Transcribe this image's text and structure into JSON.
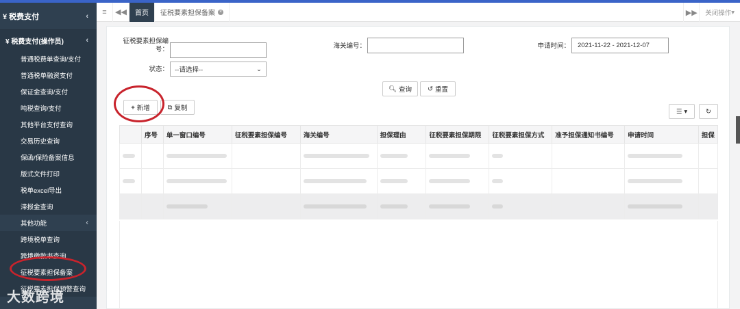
{
  "sidebar": {
    "title": "¥ 税费支付",
    "sub_title": "¥ 税费支付(操作员)",
    "items": [
      "普通税费单查询/支付",
      "普通税单融资支付",
      "保证金查询/支付",
      "吨税查询/支付",
      "其他平台支付查询",
      "交易历史查询",
      "保函/保险备案信息",
      "版式文件打印",
      "税单excel导出",
      "滞报金查询"
    ],
    "group_label": "其他功能",
    "group_items": [
      "跨境税单查询",
      "跨境缴款书查询",
      "征税要素担保备案",
      "征税要素担保预警查询"
    ],
    "watermark": "大数跨境"
  },
  "tabs": {
    "home": "首页",
    "current": "征税要素担保备案",
    "close_ops": "关闭操作"
  },
  "form": {
    "guarantee_no_label": "征税要素担保编号：",
    "customs_no_label": "海关编号：",
    "apply_time_label": "申请时间：",
    "apply_time_value": "2021-11-22 - 2021-12-07",
    "status_label": "状态：",
    "status_value": "--请选择--",
    "query_btn": "查询",
    "reset_btn": "重置"
  },
  "toolbar": {
    "add_btn": "新增",
    "copy_btn": "复制"
  },
  "table": {
    "columns": [
      "序号",
      "单一窗口编号",
      "征税要素担保编号",
      "海关编号",
      "担保理由",
      "征税要素担保期限",
      "征税要素担保方式",
      "准予担保通知书编号",
      "申请时间",
      "担保"
    ]
  },
  "colors": {
    "sidebar_bg": "#2f4050",
    "accent": "#3a64c8",
    "highlight": "#c8232c"
  }
}
